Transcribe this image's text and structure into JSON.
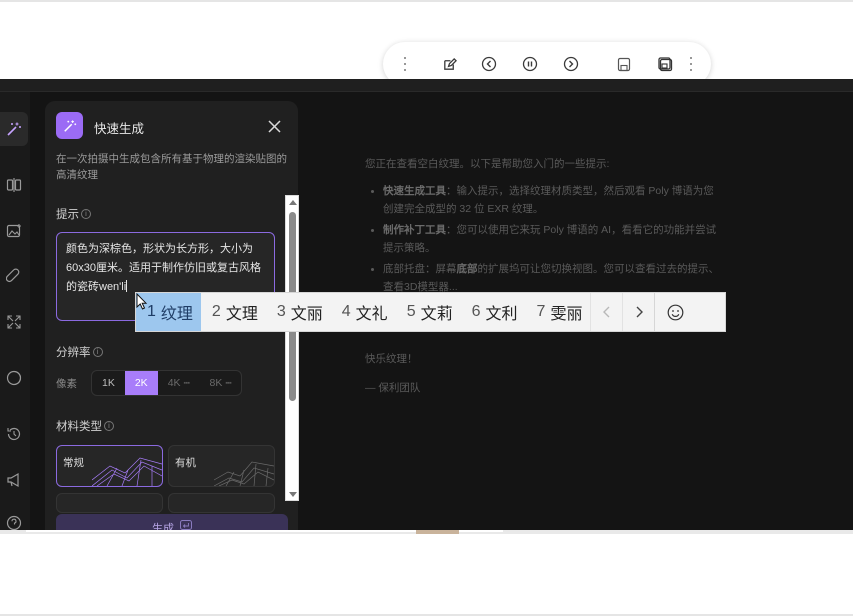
{
  "toolbar": {
    "items": [
      "more-icon",
      "edit-icon",
      "previous-icon",
      "pause-icon",
      "next-icon",
      "save-icon",
      "save-all-icon",
      "more-icon"
    ]
  },
  "rail": {
    "items": [
      "magic-wand-icon",
      "compare-icon",
      "image-upload-icon",
      "patch-icon",
      "expand-icon",
      "sphere-icon",
      "history-icon",
      "announcement-icon",
      "help-icon"
    ]
  },
  "panel": {
    "title": "快速生成",
    "description": "在一次拍摄中生成包含所有基于物理的渲染贴图的高清纹理",
    "prompt_label": "提示",
    "prompt_value": "颜色为深棕色，形状为长方形，大小为60x30厘米。适用于制作仿旧或复古风格的瓷砖wen'li",
    "resolution_label": "分辨率",
    "resolution_prefix": "像素",
    "resolution_options": [
      {
        "label": "1K",
        "state": "normal"
      },
      {
        "label": "2K",
        "state": "selected"
      },
      {
        "label": "4K",
        "state": "disabled"
      },
      {
        "label": "8K",
        "state": "disabled"
      }
    ],
    "material_label": "材料类型",
    "materials": [
      {
        "label": "常规",
        "selected": true
      },
      {
        "label": "有机",
        "selected": false
      }
    ],
    "generate_label": "生成"
  },
  "canvas": {
    "intro": "您正在查看空白纹理。以下是帮助您入门的一些提示:",
    "tips": [
      {
        "bold": "快速生成工具",
        "text": "：输入提示，选择纹理材质类型，然后观看 Poly 博语为您创建完全成型的 32 位 EXR 纹理。"
      },
      {
        "bold": "制作补丁工具",
        "text": "：您可以使用它来玩 Poly 博语的 AI，看看它的功能并尝试提示策略。"
      },
      {
        "pre": "底部托盘：屏幕",
        "bold": "底部",
        "text": "的扩展坞可让您切换视图。您可以查看过去的提示、查看3D模型器..."
      }
    ],
    "closing": "快乐纹理！",
    "signature": "— 保利团队"
  },
  "ime": {
    "candidates": [
      {
        "num": "1",
        "word": "纹理",
        "selected": true
      },
      {
        "num": "2",
        "word": "文理",
        "selected": false
      },
      {
        "num": "3",
        "word": "文丽",
        "selected": false
      },
      {
        "num": "4",
        "word": "文礼",
        "selected": false
      },
      {
        "num": "5",
        "word": "文莉",
        "selected": false
      },
      {
        "num": "6",
        "word": "文利",
        "selected": false
      },
      {
        "num": "7",
        "word": "雯丽",
        "selected": false
      }
    ]
  },
  "colors": {
    "accent": "#a87dfa",
    "dark_bg": "#141414",
    "panel_bg": "#202020",
    "ime_selected": "#9dc7ee"
  }
}
